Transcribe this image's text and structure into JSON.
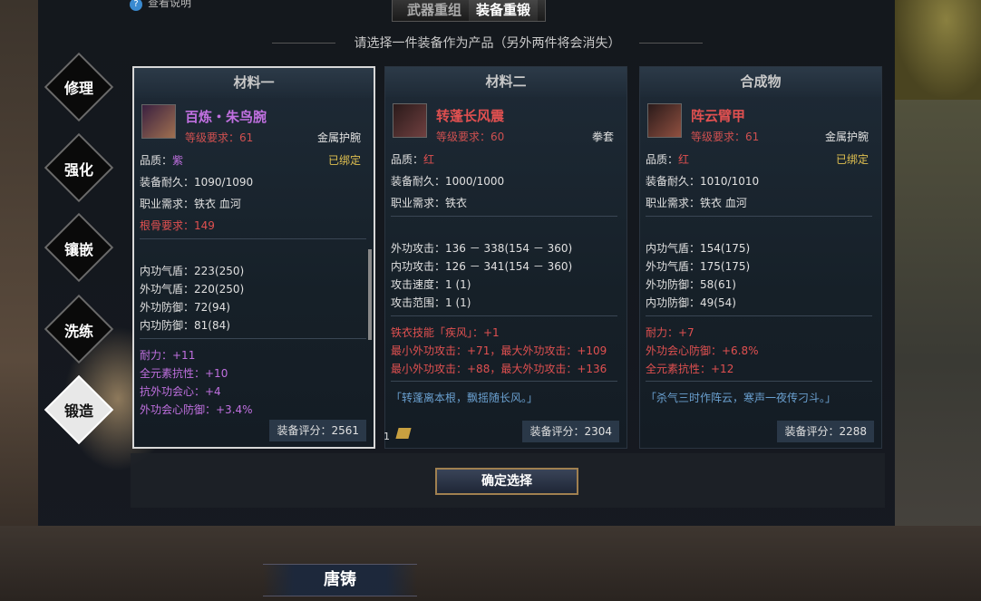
{
  "help": {
    "label": "查看说明"
  },
  "tabs": [
    {
      "label": "武器重组"
    },
    {
      "label": "装备重锻"
    }
  ],
  "subtitle": "请选择一件装备作为产品（另外两件将会消失）",
  "side_menu": [
    {
      "label": "修理"
    },
    {
      "label": "强化"
    },
    {
      "label": "镶嵌"
    },
    {
      "label": "洗练"
    },
    {
      "label": "锻造"
    }
  ],
  "cards": [
    {
      "header": "材料一",
      "name": "百炼・朱鸟腕",
      "name_color": "#c070e0",
      "level": "等级要求：61",
      "slot": "金属护腕",
      "quality_label": "品质：",
      "quality": "紫",
      "bound": "已绑定",
      "durability": "装备耐久：1090/1090",
      "class_req": "职业需求：铁衣 血河",
      "extra_req": "根骨要求：149",
      "stats": [
        "内功气盾：223(250)",
        "外功气盾：220(250)",
        "外功防御：72(94)",
        "内功防御：81(84)"
      ],
      "bonuses": [
        "耐力：+11",
        "全元素抗性：+10",
        "抗外功会心：+4",
        "外功会心防御：+3.4%"
      ],
      "score": "装备评分：2561"
    },
    {
      "header": "材料二",
      "name": "转蓬长风震",
      "name_color": "#e05050",
      "level": "等级要求：60",
      "slot": "拳套",
      "quality_label": "品质：",
      "quality": "红",
      "durability": "装备耐久：1000/1000",
      "class_req": "职业需求：铁衣",
      "stats": [
        "外功攻击：136 － 338(154 － 360)",
        "内功攻击：126 － 341(154 － 360)",
        "攻击速度：1 (1)",
        "攻击范围：1 (1)"
      ],
      "bonuses": [
        "铁衣技能「疾风」：+1",
        "最小外功攻击：+71，最大外功攻击：+109",
        "最小外功攻击：+88，最大外功攻击：+136"
      ],
      "quote": "「转蓬离本根，飘摇随长风。」",
      "score": "装备评分：2304"
    },
    {
      "header": "合成物",
      "name": "阵云臂甲",
      "name_color": "#e05050",
      "level": "等级要求：61",
      "slot": "金属护腕",
      "quality_label": "品质：",
      "quality": "红",
      "bound": "已绑定",
      "durability": "装备耐久：1010/1010",
      "class_req": "职业需求：铁衣 血河",
      "stats": [
        "内功气盾：154(175)",
        "外功气盾：175(175)",
        "外功防御：58(61)",
        "内功防御：49(54)"
      ],
      "bonuses": [
        "耐力：+7",
        "外功会心防御：+6.8%",
        "全元素抗性：+12"
      ],
      "quote": "「杀气三时作阵云，寒声一夜传刁斗。」",
      "score": "装备评分：2288"
    }
  ],
  "currency_count": "1",
  "confirm_label": "确定选择",
  "bottom_title": "唐铸"
}
